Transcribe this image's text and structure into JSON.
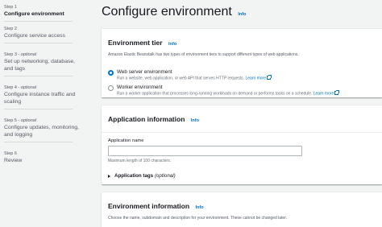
{
  "sidebar": {
    "steps": [
      {
        "step": "Step 1",
        "optional": "",
        "title": "Configure environment",
        "active": true
      },
      {
        "step": "Step 2",
        "optional": "",
        "title": "Configure service access",
        "active": false
      },
      {
        "step": "Step 3",
        "optional": "optional",
        "title": "Set up networking, database, and tags",
        "active": false
      },
      {
        "step": "Step 4",
        "optional": "optional",
        "title": "Configure instance traffic and scaling",
        "active": false
      },
      {
        "step": "Step 5",
        "optional": "optional",
        "title": "Configure updates, monitoring, and logging",
        "active": false
      },
      {
        "step": "Step 6",
        "optional": "",
        "title": "Review",
        "active": false
      }
    ],
    "optional_separator": " - "
  },
  "page": {
    "title": "Configure environment",
    "info": "Info"
  },
  "environment_tier": {
    "title": "Environment tier",
    "info": "Info",
    "description": "Amazon Elastic Beanstalk has two types of environment tiers to support different types of web applications.",
    "options": [
      {
        "label": "Web server environment",
        "description": "Run a website, web application, or web API that serves HTTP requests.",
        "learn_more": "Learn more",
        "checked": true
      },
      {
        "label": "Worker environment",
        "description": "Run a worker application that processes long-running workloads on demand or performs tasks on a schedule.",
        "learn_more": "Learn more",
        "checked": false
      }
    ]
  },
  "application_information": {
    "title": "Application information",
    "info": "Info",
    "name_label": "Application name",
    "name_value": "",
    "name_hint": "Maximum length of 100 characters.",
    "tags_label": "Application tags",
    "tags_optional": "(optional)"
  },
  "environment_information": {
    "title": "Environment information",
    "info": "Info",
    "description": "Choose the name, subdomain and description for your environment. These cannot be changed later."
  },
  "colors": {
    "link": "#0073bb",
    "background": "#f2f3f3",
    "text": "#16191f"
  }
}
